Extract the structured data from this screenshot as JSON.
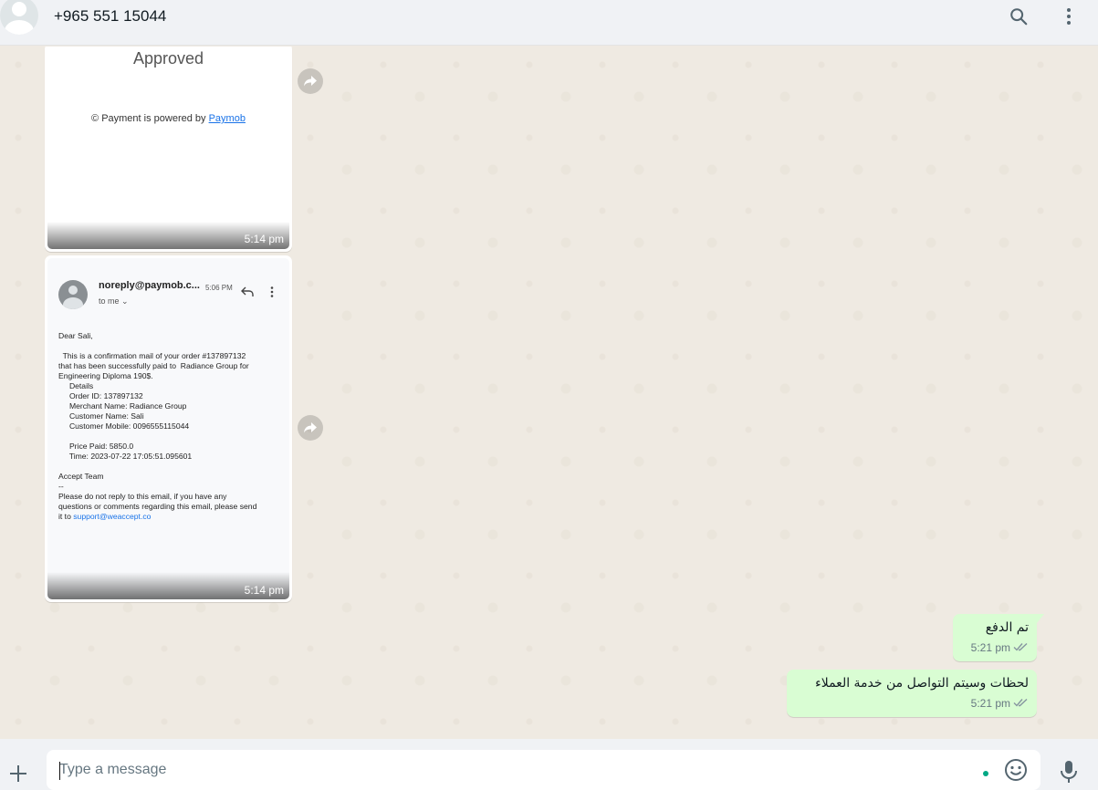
{
  "header": {
    "contact_name": "+965 551 15044",
    "icons": [
      "search-icon",
      "menu-dots-icon"
    ]
  },
  "messages": [
    {
      "type": "image",
      "direction": "incoming",
      "time": "5:14 pm",
      "image": {
        "status_text": "Approved",
        "powered_prefix": "© Payment is powered by ",
        "powered_link": "Paymob"
      }
    },
    {
      "type": "image",
      "direction": "incoming",
      "time": "5:14 pm",
      "email": {
        "sender": "noreply@paymob.c...",
        "time": "5:06 PM",
        "to": "to me",
        "greeting": "Dear Sali,",
        "line1": "  This is a confirmation mail of your order #137897132",
        "line2": "that has been successfully paid to  Radiance Group for",
        "line3": "Engineering Diploma 190$.",
        "details_label": "     Details",
        "order_id": "     Order ID: 137897132",
        "merchant": "     Merchant Name: Radiance Group",
        "customer_name": "     Customer Name: Sali",
        "customer_mobile": "     Customer Mobile: 0096555115044",
        "price_paid": "     Price Paid: 5850.0",
        "time_paid": "     Time: 2023-07-22 17:05:51.095601",
        "sign": "Accept Team",
        "dash": "--",
        "footer1": "Please do not reply to this email, if you have any",
        "footer2": "questions or comments regarding this email, please send",
        "footer3_prefix": "it to ",
        "footer3_link": "support@weaccept.co"
      }
    },
    {
      "type": "text",
      "direction": "outgoing",
      "text": "تم الدفع",
      "time": "5:21 pm",
      "status": "read"
    },
    {
      "type": "text",
      "direction": "outgoing",
      "text": "لحظات وسيتم التواصل من خدمة العملاء",
      "time": "5:21 pm",
      "status": "read"
    }
  ],
  "composer": {
    "placeholder": "Type a message",
    "value": ""
  },
  "colors": {
    "header_bg": "#f0f2f5",
    "chat_bg": "#efeae2",
    "outgoing_bubble": "#d9fdd3",
    "accent": "#00a884",
    "read_ticks": "#8696a0",
    "link": "#1a73e8"
  }
}
